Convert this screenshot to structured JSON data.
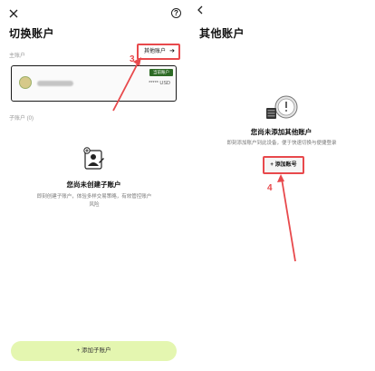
{
  "left": {
    "title": "切换账户",
    "main_account_label": "主账户",
    "other_accounts_label": "其他账户",
    "other_accounts_arrow": "➔",
    "card": {
      "badge": "当前账户",
      "balance": "***** USD"
    },
    "sub_accounts_label": "子账户 (0)",
    "empty_title": "您尚未创建子账户",
    "empty_desc": "即刻创建子账户，体验多样交易策略，有效管控账户风险",
    "add_sub_button": "+ 添加子账户"
  },
  "right": {
    "title": "其他账户",
    "empty_title": "您尚未添加其他账户",
    "empty_desc": "即刻添加账户到此设备，便于快速切换与便捷登录",
    "add_button": "+ 添加账号"
  },
  "annotations": {
    "step_3": "3",
    "step_4": "4"
  },
  "colors": {
    "annotation_red": "#e8494c",
    "accent_lime": "#e4f6b0",
    "badge_green": "#2d6b25"
  }
}
